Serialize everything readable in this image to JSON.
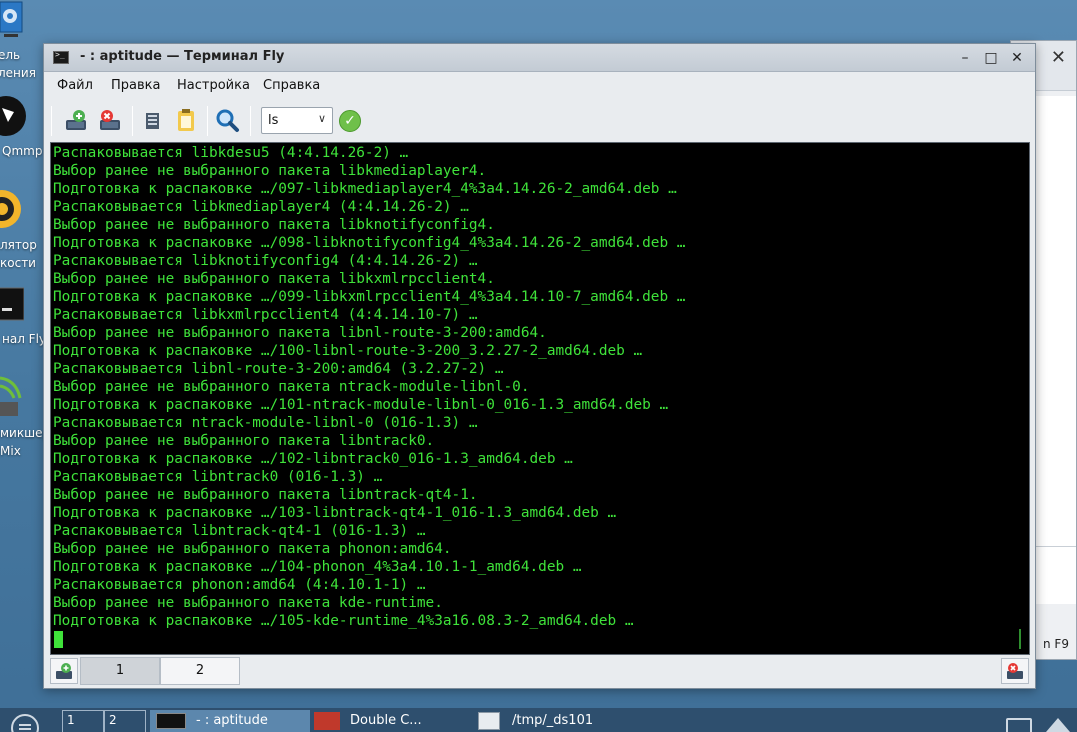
{
  "desktop": {
    "icons": [
      {
        "label_line1": "ель",
        "label_line2": "ления"
      },
      {
        "label_line1": "Qmmp"
      },
      {
        "label_line1": "лятор",
        "label_line2": "кости"
      },
      {
        "label_line1": "нал Fly"
      },
      {
        "label_line1": "микшер",
        "label_line2": "Mix"
      }
    ]
  },
  "background_window": {
    "hint": "n F9"
  },
  "window": {
    "title": "- : aptitude — Терминал Fly",
    "controls": {
      "minimize": "–",
      "maximize": "□",
      "close": "✕"
    },
    "menu": [
      "Файл",
      "Правка",
      "Настройка",
      "Справка"
    ],
    "toolbar": {
      "combo_value": "ls",
      "icons": [
        "new-tab-icon",
        "close-tab-icon",
        "copy-icon",
        "paste-icon",
        "find-icon",
        "execute-icon"
      ]
    },
    "terminal": {
      "lines": [
        "Распаковывается libkdesu5 (4:4.14.26-2) …",
        "Выбор ранее не выбранного пакета libkmediaplayer4.",
        "Подготовка к распаковке …/097-libkmediaplayer4_4%3a4.14.26-2_amd64.deb …",
        "Распаковывается libkmediaplayer4 (4:4.14.26-2) …",
        "Выбор ранее не выбранного пакета libknotifyconfig4.",
        "Подготовка к распаковке …/098-libknotifyconfig4_4%3a4.14.26-2_amd64.deb …",
        "Распаковывается libknotifyconfig4 (4:4.14.26-2) …",
        "Выбор ранее не выбранного пакета libkxmlrpcclient4.",
        "Подготовка к распаковке …/099-libkxmlrpcclient4_4%3a4.14.10-7_amd64.deb …",
        "Распаковывается libkxmlrpcclient4 (4:4.14.10-7) …",
        "Выбор ранее не выбранного пакета libnl-route-3-200:amd64.",
        "Подготовка к распаковке …/100-libnl-route-3-200_3.2.27-2_amd64.deb …",
        "Распаковывается libnl-route-3-200:amd64 (3.2.27-2) …",
        "Выбор ранее не выбранного пакета ntrack-module-libnl-0.",
        "Подготовка к распаковке …/101-ntrack-module-libnl-0_016-1.3_amd64.deb …",
        "Распаковывается ntrack-module-libnl-0 (016-1.3) …",
        "Выбор ранее не выбранного пакета libntrack0.",
        "Подготовка к распаковке …/102-libntrack0_016-1.3_amd64.deb …",
        "Распаковывается libntrack0 (016-1.3) …",
        "Выбор ранее не выбранного пакета libntrack-qt4-1.",
        "Подготовка к распаковке …/103-libntrack-qt4-1_016-1.3_amd64.deb …",
        "Распаковывается libntrack-qt4-1 (016-1.3) …",
        "Выбор ранее не выбранного пакета phonon:amd64.",
        "Подготовка к распаковке …/104-phonon_4%3a4.10.1-1_amd64.deb …",
        "Распаковывается phonon:amd64 (4:4.10.1-1) …",
        "Выбор ранее не выбранного пакета kde-runtime.",
        "Подготовка к распаковке …/105-kde-runtime_4%3a16.08.3-2_amd64.deb …"
      ]
    },
    "tabs": [
      {
        "label": "1",
        "active": true
      },
      {
        "label": "2",
        "active": false
      }
    ]
  },
  "taskbar": {
    "desktops": [
      "1",
      "2"
    ],
    "tasks": [
      {
        "label": "- : aptitude"
      },
      {
        "label": "Double C..."
      },
      {
        "label": "/tmp/_ds101"
      }
    ]
  },
  "colors": {
    "terminal_bg": "#000000",
    "terminal_fg": "#3fe23a",
    "desktop_bg": "#4e7fa6",
    "taskbar_bg": "#2e4f6e"
  }
}
